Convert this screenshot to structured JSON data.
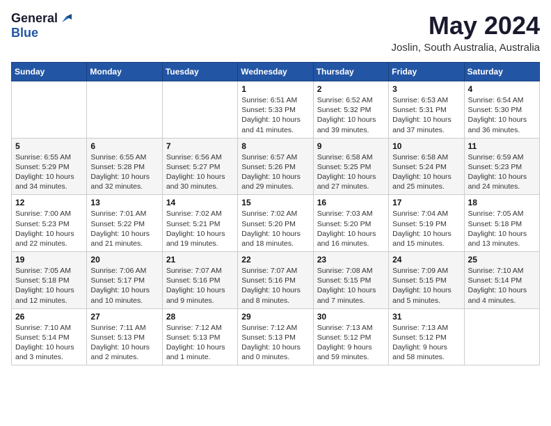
{
  "logo": {
    "general": "General",
    "blue": "Blue"
  },
  "title": "May 2024",
  "location": "Joslin, South Australia, Australia",
  "weekdays": [
    "Sunday",
    "Monday",
    "Tuesday",
    "Wednesday",
    "Thursday",
    "Friday",
    "Saturday"
  ],
  "weeks": [
    [
      {
        "day": "",
        "info": ""
      },
      {
        "day": "",
        "info": ""
      },
      {
        "day": "",
        "info": ""
      },
      {
        "day": "1",
        "info": "Sunrise: 6:51 AM\nSunset: 5:33 PM\nDaylight: 10 hours\nand 41 minutes."
      },
      {
        "day": "2",
        "info": "Sunrise: 6:52 AM\nSunset: 5:32 PM\nDaylight: 10 hours\nand 39 minutes."
      },
      {
        "day": "3",
        "info": "Sunrise: 6:53 AM\nSunset: 5:31 PM\nDaylight: 10 hours\nand 37 minutes."
      },
      {
        "day": "4",
        "info": "Sunrise: 6:54 AM\nSunset: 5:30 PM\nDaylight: 10 hours\nand 36 minutes."
      }
    ],
    [
      {
        "day": "5",
        "info": "Sunrise: 6:55 AM\nSunset: 5:29 PM\nDaylight: 10 hours\nand 34 minutes."
      },
      {
        "day": "6",
        "info": "Sunrise: 6:55 AM\nSunset: 5:28 PM\nDaylight: 10 hours\nand 32 minutes."
      },
      {
        "day": "7",
        "info": "Sunrise: 6:56 AM\nSunset: 5:27 PM\nDaylight: 10 hours\nand 30 minutes."
      },
      {
        "day": "8",
        "info": "Sunrise: 6:57 AM\nSunset: 5:26 PM\nDaylight: 10 hours\nand 29 minutes."
      },
      {
        "day": "9",
        "info": "Sunrise: 6:58 AM\nSunset: 5:25 PM\nDaylight: 10 hours\nand 27 minutes."
      },
      {
        "day": "10",
        "info": "Sunrise: 6:58 AM\nSunset: 5:24 PM\nDaylight: 10 hours\nand 25 minutes."
      },
      {
        "day": "11",
        "info": "Sunrise: 6:59 AM\nSunset: 5:23 PM\nDaylight: 10 hours\nand 24 minutes."
      }
    ],
    [
      {
        "day": "12",
        "info": "Sunrise: 7:00 AM\nSunset: 5:23 PM\nDaylight: 10 hours\nand 22 minutes."
      },
      {
        "day": "13",
        "info": "Sunrise: 7:01 AM\nSunset: 5:22 PM\nDaylight: 10 hours\nand 21 minutes."
      },
      {
        "day": "14",
        "info": "Sunrise: 7:02 AM\nSunset: 5:21 PM\nDaylight: 10 hours\nand 19 minutes."
      },
      {
        "day": "15",
        "info": "Sunrise: 7:02 AM\nSunset: 5:20 PM\nDaylight: 10 hours\nand 18 minutes."
      },
      {
        "day": "16",
        "info": "Sunrise: 7:03 AM\nSunset: 5:20 PM\nDaylight: 10 hours\nand 16 minutes."
      },
      {
        "day": "17",
        "info": "Sunrise: 7:04 AM\nSunset: 5:19 PM\nDaylight: 10 hours\nand 15 minutes."
      },
      {
        "day": "18",
        "info": "Sunrise: 7:05 AM\nSunset: 5:18 PM\nDaylight: 10 hours\nand 13 minutes."
      }
    ],
    [
      {
        "day": "19",
        "info": "Sunrise: 7:05 AM\nSunset: 5:18 PM\nDaylight: 10 hours\nand 12 minutes."
      },
      {
        "day": "20",
        "info": "Sunrise: 7:06 AM\nSunset: 5:17 PM\nDaylight: 10 hours\nand 10 minutes."
      },
      {
        "day": "21",
        "info": "Sunrise: 7:07 AM\nSunset: 5:16 PM\nDaylight: 10 hours\nand 9 minutes."
      },
      {
        "day": "22",
        "info": "Sunrise: 7:07 AM\nSunset: 5:16 PM\nDaylight: 10 hours\nand 8 minutes."
      },
      {
        "day": "23",
        "info": "Sunrise: 7:08 AM\nSunset: 5:15 PM\nDaylight: 10 hours\nand 7 minutes."
      },
      {
        "day": "24",
        "info": "Sunrise: 7:09 AM\nSunset: 5:15 PM\nDaylight: 10 hours\nand 5 minutes."
      },
      {
        "day": "25",
        "info": "Sunrise: 7:10 AM\nSunset: 5:14 PM\nDaylight: 10 hours\nand 4 minutes."
      }
    ],
    [
      {
        "day": "26",
        "info": "Sunrise: 7:10 AM\nSunset: 5:14 PM\nDaylight: 10 hours\nand 3 minutes."
      },
      {
        "day": "27",
        "info": "Sunrise: 7:11 AM\nSunset: 5:13 PM\nDaylight: 10 hours\nand 2 minutes."
      },
      {
        "day": "28",
        "info": "Sunrise: 7:12 AM\nSunset: 5:13 PM\nDaylight: 10 hours\nand 1 minute."
      },
      {
        "day": "29",
        "info": "Sunrise: 7:12 AM\nSunset: 5:13 PM\nDaylight: 10 hours\nand 0 minutes."
      },
      {
        "day": "30",
        "info": "Sunrise: 7:13 AM\nSunset: 5:12 PM\nDaylight: 9 hours\nand 59 minutes."
      },
      {
        "day": "31",
        "info": "Sunrise: 7:13 AM\nSunset: 5:12 PM\nDaylight: 9 hours\nand 58 minutes."
      },
      {
        "day": "",
        "info": ""
      }
    ]
  ]
}
